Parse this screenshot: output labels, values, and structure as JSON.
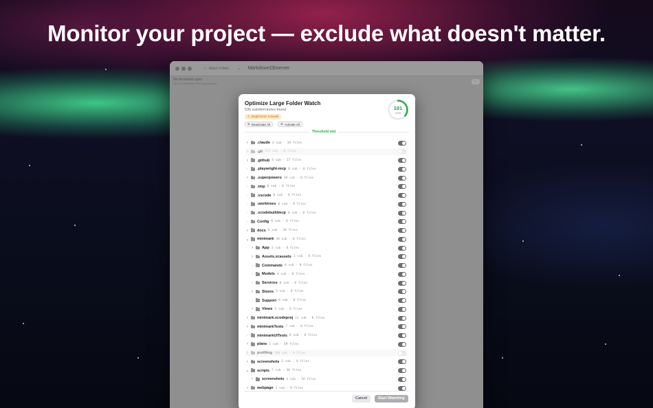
{
  "headline": "Monitor your project — exclude what doesn't matter.",
  "window": {
    "toolbar_button": "Watch Folder",
    "title": "MarkdownObserver",
    "doc_title": "No document open",
    "doc_subtitle": "Open a Markdown file to get started",
    "more_label": "···"
  },
  "dialog": {
    "title": "Optimize Large Folder Watch",
    "subtitle": "535 subdirectories found",
    "warning": "Depth limit: 6 levels",
    "deactivate_all": "Deactivate All",
    "activate_all": "Activate All",
    "count": "101",
    "count_unit": "/278",
    "progress_fraction": 0.36,
    "threshold_label": "Threshold met",
    "cancel": "Cancel",
    "start": "Start Watching",
    "accent_color": "#2aa84a"
  },
  "tree": [
    {
      "name": ".claude",
      "meta": "4 sub · 38 files",
      "depth": 0,
      "chev": "›",
      "on": true
    },
    {
      "name": ".git",
      "meta": "272 sub · 0 files",
      "depth": 0,
      "chev": "›",
      "on": false,
      "excluded": true
    },
    {
      "name": ".github",
      "meta": "4 sub · 27 files",
      "depth": 0,
      "chev": "›",
      "on": true
    },
    {
      "name": ".playwright-mcp",
      "meta": "0 sub · 0 files",
      "depth": 0,
      "chev": "·",
      "on": true
    },
    {
      "name": ".superpowers",
      "meta": "19 sub · 0 files",
      "depth": 0,
      "chev": "›",
      "on": true
    },
    {
      "name": ".tmp",
      "meta": "0 sub · 0 files",
      "depth": 0,
      "chev": "·",
      "on": true
    },
    {
      "name": ".vscode",
      "meta": "0 sub · 0 files",
      "depth": 0,
      "chev": "·",
      "on": true
    },
    {
      "name": ".worktrees",
      "meta": "0 sub · 0 files",
      "depth": 0,
      "chev": "·",
      "on": true
    },
    {
      "name": ".xcodebuildmcp",
      "meta": "0 sub · 0 files",
      "depth": 0,
      "chev": "·",
      "on": true
    },
    {
      "name": "Config",
      "meta": "0 sub · 0 files",
      "depth": 0,
      "chev": "·",
      "on": true
    },
    {
      "name": "docs",
      "meta": "6 sub · 36 files",
      "depth": 0,
      "chev": "›",
      "on": true
    },
    {
      "name": "minimark",
      "meta": "20 sub · 0 files",
      "depth": 0,
      "chev": "⌄",
      "on": true
    },
    {
      "name": "App",
      "meta": "3 sub · 0 files",
      "depth": 1,
      "chev": "›",
      "on": true
    },
    {
      "name": "Assets.xcassets",
      "meta": "2 sub · 0 files",
      "depth": 1,
      "chev": "›",
      "on": true
    },
    {
      "name": "Commands",
      "meta": "0 sub · 0 files",
      "depth": 1,
      "chev": "·",
      "on": true
    },
    {
      "name": "Models",
      "meta": "0 sub · 0 files",
      "depth": 1,
      "chev": "·",
      "on": true
    },
    {
      "name": "Services",
      "meta": "0 sub · 0 files",
      "depth": 1,
      "chev": "·",
      "on": true
    },
    {
      "name": "Stores",
      "meta": "3 sub · 0 files",
      "depth": 1,
      "chev": "›",
      "on": true
    },
    {
      "name": "Support",
      "meta": "0 sub · 0 files",
      "depth": 1,
      "chev": "·",
      "on": true
    },
    {
      "name": "Views",
      "meta": "5 sub · 0 files",
      "depth": 1,
      "chev": "›",
      "on": true
    },
    {
      "name": "minimark.xcodeproj",
      "meta": "11 sub · 0 files",
      "depth": 0,
      "chev": "›",
      "on": true
    },
    {
      "name": "minimarkTests",
      "meta": "7 sub · 0 files",
      "depth": 0,
      "chev": "›",
      "on": true
    },
    {
      "name": "minimarkUITests",
      "meta": "0 sub · 0 files",
      "depth": 0,
      "chev": "·",
      "on": true
    },
    {
      "name": "plans",
      "meta": "1 sub · 69 files",
      "depth": 0,
      "chev": "›",
      "on": true
    },
    {
      "name": "profiling",
      "meta": "108 sub · 0 files",
      "depth": 0,
      "chev": "›",
      "on": false,
      "excluded": true
    },
    {
      "name": "screenshots",
      "meta": "2 sub · 0 files",
      "depth": 0,
      "chev": "›",
      "on": true
    },
    {
      "name": "scripts",
      "meta": "7 sub · 36 files",
      "depth": 0,
      "chev": "⌄",
      "on": true
    },
    {
      "name": "screenshots",
      "meta": "4 sub · 34 files",
      "depth": 1,
      "chev": "›",
      "on": true
    },
    {
      "name": "webpage",
      "meta": "1 sub · 0 files",
      "depth": 0,
      "chev": "›",
      "on": true
    }
  ]
}
